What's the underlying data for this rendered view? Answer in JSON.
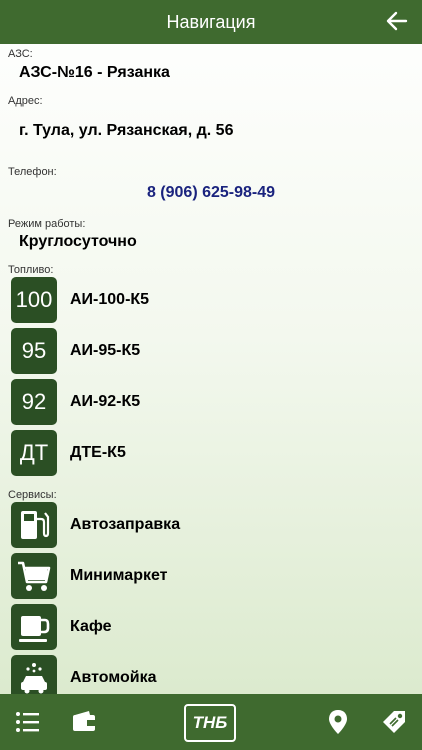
{
  "header": {
    "title": "Навигация",
    "back_icon": "arrow-left-icon"
  },
  "station": {
    "name_label": "АЗС:",
    "name": "АЗС-№16 - Рязанка",
    "address_label": "Адрес:",
    "address": "г. Тула, ул. Рязанская, д. 56",
    "phone_label": "Телефон:",
    "phone": "8 (906) 625-98-49",
    "hours_label": "Режим работы:",
    "hours": "Круглосуточно"
  },
  "fuel": {
    "label": "Топливо:",
    "items": [
      {
        "badge": "100",
        "name": "АИ-100-К5"
      },
      {
        "badge": "95",
        "name": "АИ-95-К5"
      },
      {
        "badge": "92",
        "name": "АИ-92-К5"
      },
      {
        "badge": "ДТ",
        "name": "ДТЕ-К5"
      }
    ]
  },
  "services": {
    "label": "Сервисы:",
    "items": [
      {
        "icon": "fuel-pump-icon",
        "name": "Автозаправка"
      },
      {
        "icon": "shopping-cart-icon",
        "name": "Минимаркет"
      },
      {
        "icon": "coffee-cup-icon",
        "name": "Кафе"
      },
      {
        "icon": "car-wash-icon",
        "name": "Автомойка"
      }
    ]
  },
  "tabbar": {
    "logo": "ТНБ",
    "icons": [
      "menu-icon",
      "wallet-icon",
      "logo",
      "location-pin-icon",
      "price-tag-icon"
    ]
  },
  "colors": {
    "header": "#3f6a2f",
    "badge": "#2b4f24",
    "phone": "#1a237e"
  }
}
